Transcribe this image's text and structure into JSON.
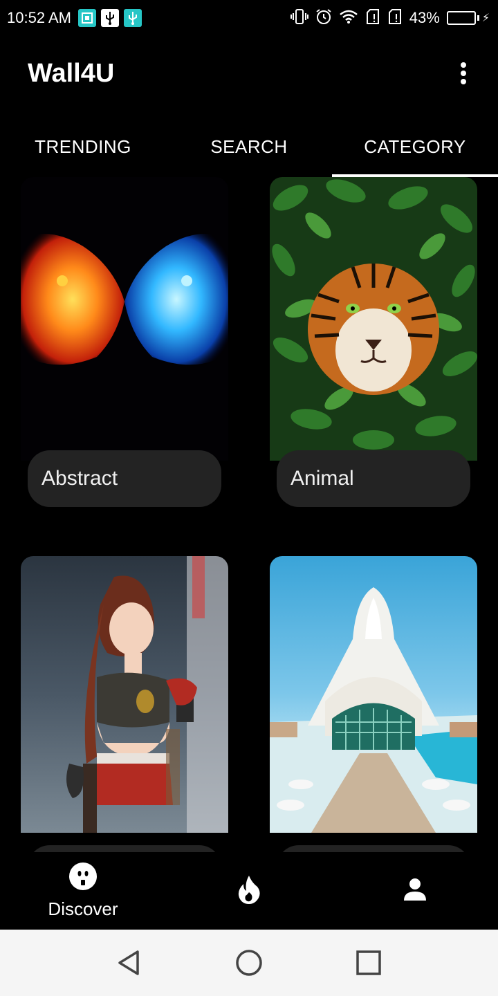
{
  "status_bar": {
    "time": "10:52 AM",
    "battery_percent": "43%",
    "battery_level": 0.43,
    "left_icons": [
      "screenshot-icon",
      "usb-icon",
      "usb-debug-icon"
    ],
    "right_icons": [
      "vibrate-icon",
      "alarm-icon",
      "wifi-icon",
      "sim-icon",
      "sim-icon",
      "battery-icon"
    ]
  },
  "app_bar": {
    "title": "Wall4U",
    "menu_icon": "overflow-menu-icon"
  },
  "tabs": [
    {
      "label": "TRENDING",
      "active": false
    },
    {
      "label": "SEARCH",
      "active": false
    },
    {
      "label": "CATEGORY",
      "active": true
    }
  ],
  "categories": [
    {
      "label": "Abstract",
      "image": "fire and ice lions"
    },
    {
      "label": "Animal",
      "image": "tiger in leaves"
    },
    {
      "label": "",
      "image": "anime character"
    },
    {
      "label": "",
      "image": "futuristic architecture"
    }
  ],
  "bottom_nav": [
    {
      "label": "Discover",
      "icon": "discover-icon",
      "active": true
    },
    {
      "label": "",
      "icon": "flame-icon",
      "active": false
    },
    {
      "label": "",
      "icon": "profile-icon",
      "active": false
    }
  ],
  "system_nav": [
    "back-icon",
    "home-icon",
    "recents-icon"
  ],
  "colors": {
    "background": "#000000",
    "label_pill": "#232323",
    "battery_fill": "#36d65a",
    "system_nav_bg": "#f5f5f5"
  }
}
